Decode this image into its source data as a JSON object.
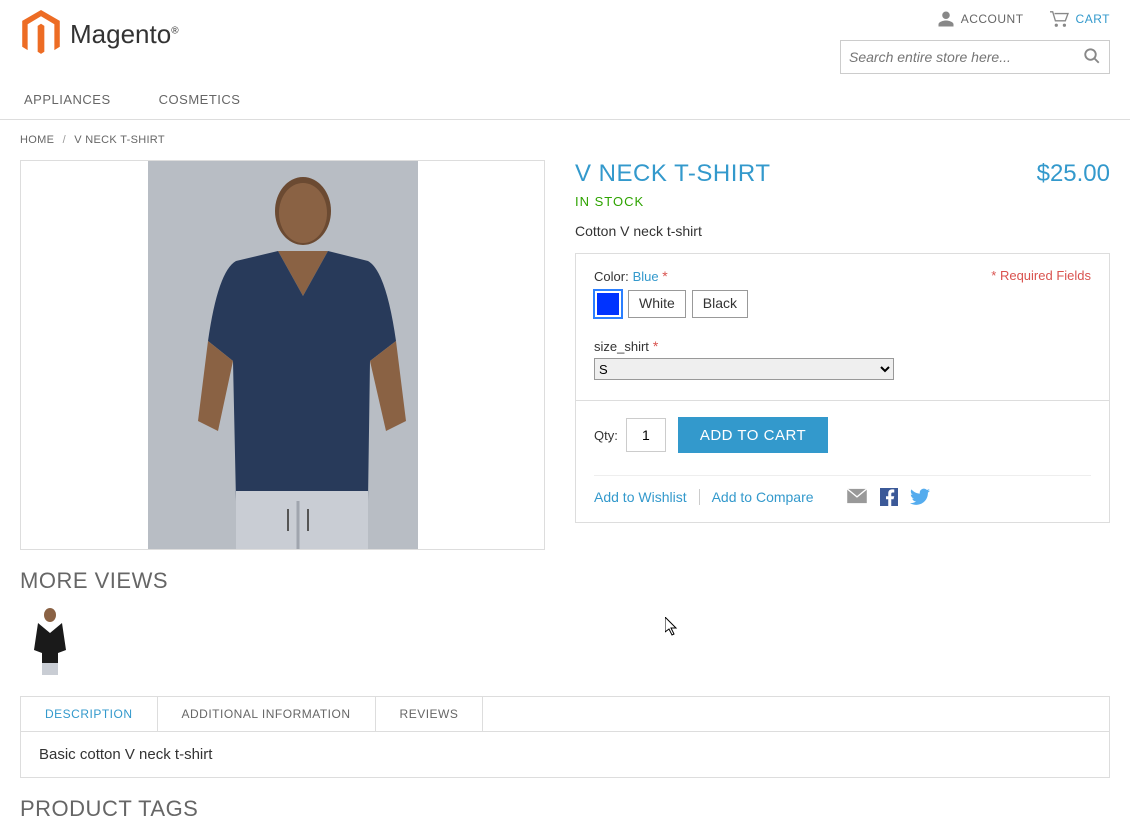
{
  "header": {
    "logo_text": "Magento",
    "account": "ACCOUNT",
    "cart": "CART",
    "search_placeholder": "Search entire store here..."
  },
  "nav": {
    "items": [
      "APPLIANCES",
      "COSMETICS"
    ]
  },
  "breadcrumb": {
    "home": "HOME",
    "current": "V NECK T-SHIRT"
  },
  "product": {
    "title": "V NECK T-SHIRT",
    "price": "$25.00",
    "stock": "IN STOCK",
    "short_desc": "Cotton V neck t-shirt",
    "required_note": "* Required Fields",
    "color_label": "Color:",
    "color_value": "Blue",
    "colors": {
      "blue_hex": "#0033ff",
      "white_label": "White",
      "black_label": "Black"
    },
    "size_label": "size_shirt",
    "size_selected": "S",
    "qty_label": "Qty:",
    "qty_value": "1",
    "addcart": "ADD TO CART",
    "wishlist": "Add to Wishlist",
    "compare": "Add to Compare"
  },
  "more_views": "MORE VIEWS",
  "tabs": {
    "description": "DESCRIPTION",
    "additional": "ADDITIONAL INFORMATION",
    "reviews": "REVIEWS",
    "desc_content": "Basic cotton V neck t-shirt"
  },
  "tags_title": "PRODUCT TAGS"
}
